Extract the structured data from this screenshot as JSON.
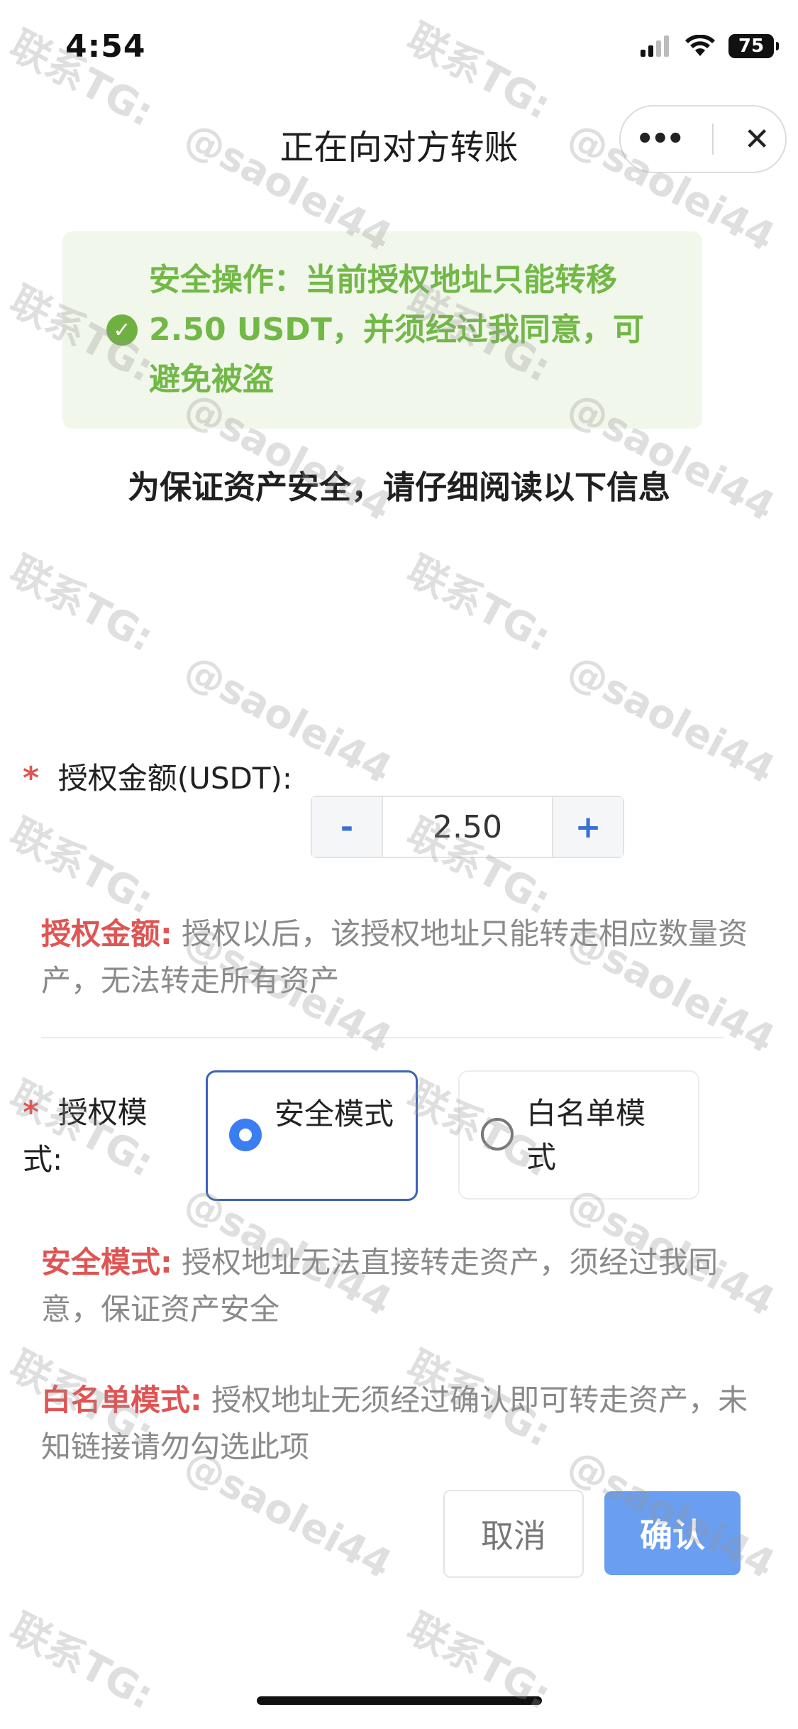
{
  "status_bar": {
    "time": "4:54",
    "battery": "75"
  },
  "header": {
    "title": "正在向对方转账",
    "more_icon": "more-icon",
    "close_icon": "close-icon"
  },
  "notice": {
    "text": "安全操作：当前授权地址只能转移2.50 USDT，并须经过我同意，可避免被盗"
  },
  "read_notice": "为保证资产安全，请仔细阅读以下信息",
  "amount": {
    "required_mark": "*",
    "label": "授权金额(USDT):",
    "minus": "-",
    "value": "2.50",
    "plus": "+",
    "desc_key": "授权金额:",
    "desc_text": " 授权以后，该授权地址只能转走相应数量资产，无法转走所有资产"
  },
  "mode": {
    "required_mark": "*",
    "label": "授权模式:",
    "options": [
      {
        "label": "安全模式",
        "selected": true
      },
      {
        "label": "白名单模式",
        "selected": false
      }
    ],
    "safe_desc_key": "安全模式:",
    "safe_desc_text": " 授权地址无法直接转走资产，须经过我同意，保证资产安全",
    "white_desc_key": "白名单模式:",
    "white_desc_text": " 授权地址无须经过确认即可转走资产，未知链接请勿勾选此项"
  },
  "buttons": {
    "cancel": "取消",
    "confirm": "确认"
  },
  "watermark": {
    "line1": "联系TG:",
    "line2": "@saolei44"
  },
  "colors": {
    "accent": "#3b7ef3",
    "confirm": "#6a9ef0",
    "success": "#72b847",
    "warning": "#e05454"
  }
}
